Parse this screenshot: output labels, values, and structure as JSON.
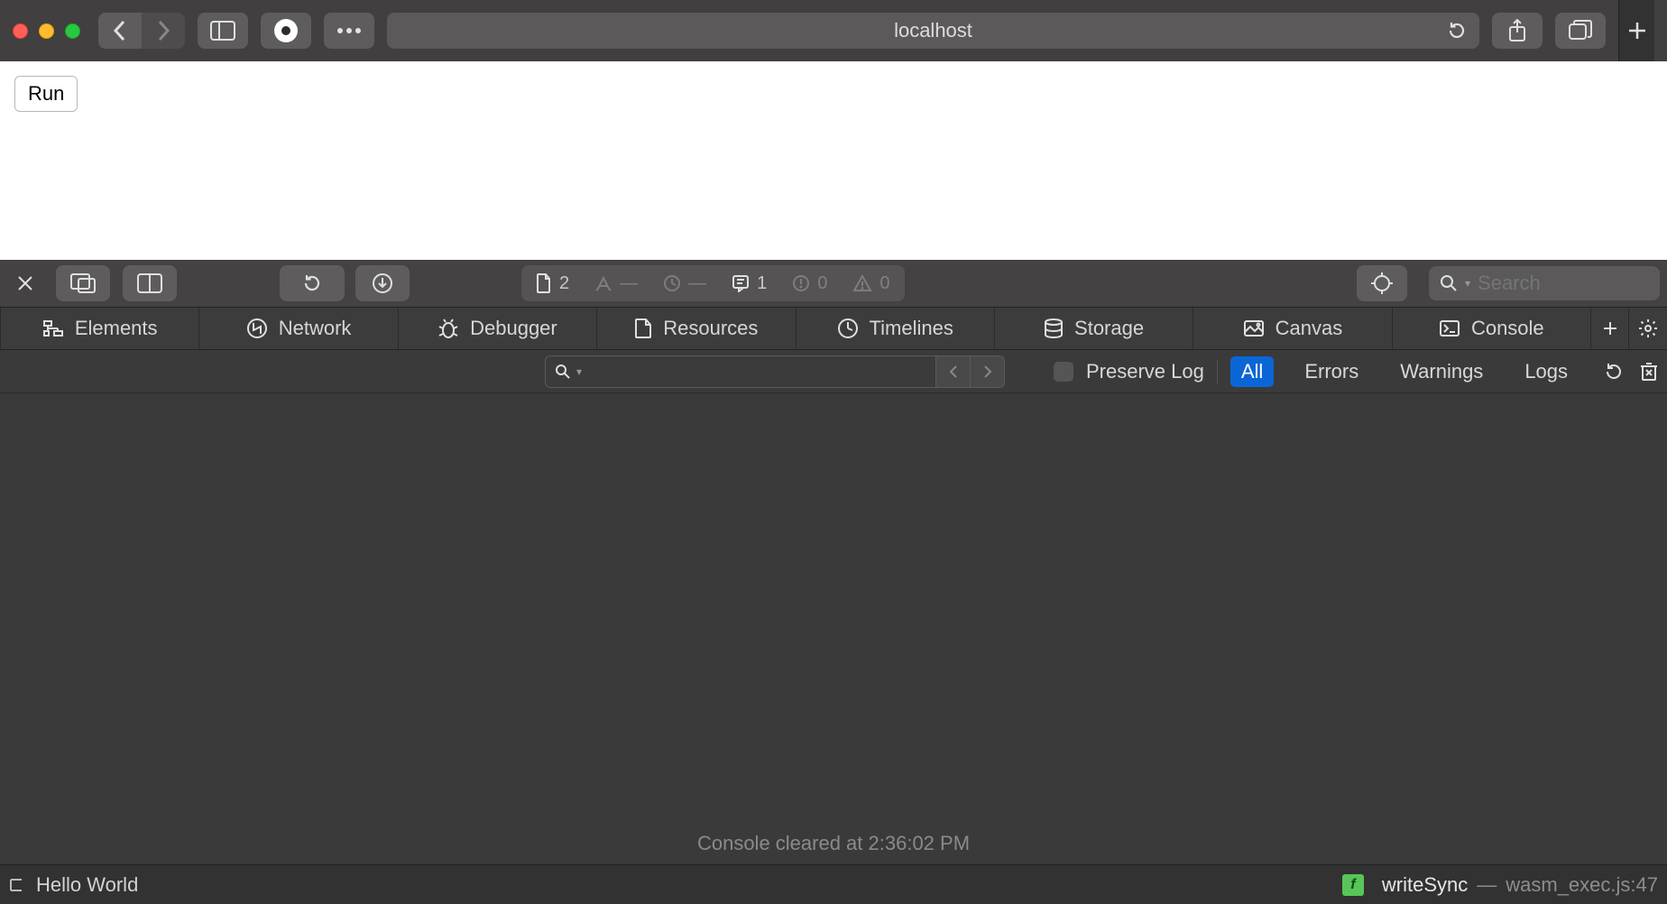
{
  "browser": {
    "address": "localhost",
    "search_placeholder": "Search"
  },
  "page": {
    "run_button": "Run"
  },
  "devtools": {
    "status": {
      "resources": "2",
      "time": "—",
      "load": "—",
      "logs": "1",
      "errors": "0",
      "warnings": "0"
    },
    "tabs": [
      "Elements",
      "Network",
      "Debugger",
      "Resources",
      "Timelines",
      "Storage",
      "Canvas",
      "Console"
    ],
    "console": {
      "preserve_label": "Preserve Log",
      "levels": {
        "all": "All",
        "errors": "Errors",
        "warnings": "Warnings",
        "logs": "Logs"
      },
      "cleared_msg": "Console cleared at 2:36:02 PM"
    }
  },
  "footer": {
    "log_text": "Hello World",
    "fn": "writeSync",
    "source": "wasm_exec.js:47"
  }
}
